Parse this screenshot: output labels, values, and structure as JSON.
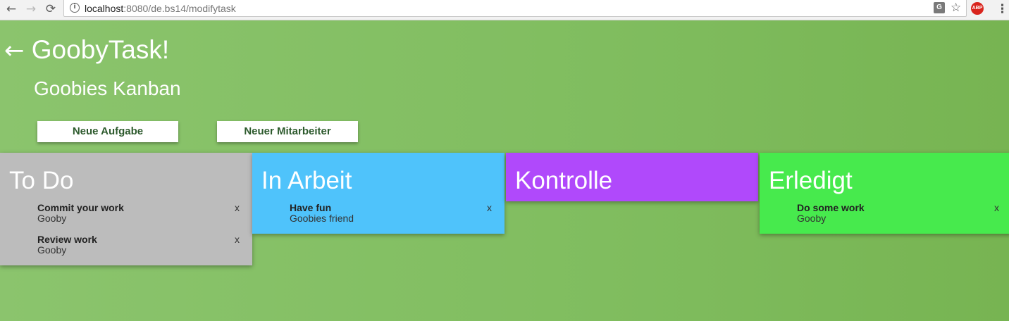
{
  "browser": {
    "url_host": "localhost",
    "url_path": ":8080/de.bs14/modifytask",
    "nav": {
      "back": "←",
      "forward": "→",
      "reload": "⟳"
    },
    "icons": {
      "info": "i",
      "translate": "G",
      "star": "☆",
      "abp": "ABP",
      "menu": "⋮"
    }
  },
  "header": {
    "back_arrow": "←",
    "app_title": "GoobyTask!",
    "board_title": "Goobies Kanban"
  },
  "actions": {
    "new_task": "Neue Aufgabe",
    "new_member": "Neuer Mitarbeiter"
  },
  "columns": [
    {
      "title": "To Do",
      "color": "#bcbcbc",
      "tasks": [
        {
          "title": "Commit your work",
          "owner": "Gooby",
          "remove": "x"
        },
        {
          "title": "Review work",
          "owner": "Gooby",
          "remove": "x"
        }
      ]
    },
    {
      "title": "In Arbeit",
      "color": "#4fc3fb",
      "tasks": [
        {
          "title": "Have fun",
          "owner": "Goobies friend",
          "remove": "x"
        }
      ]
    },
    {
      "title": "Kontrolle",
      "color": "#b049fb",
      "tasks": []
    },
    {
      "title": "Erledigt",
      "color": "#47ea4d",
      "tasks": [
        {
          "title": "Do some work",
          "owner": "Gooby",
          "remove": "x"
        }
      ]
    }
  ]
}
